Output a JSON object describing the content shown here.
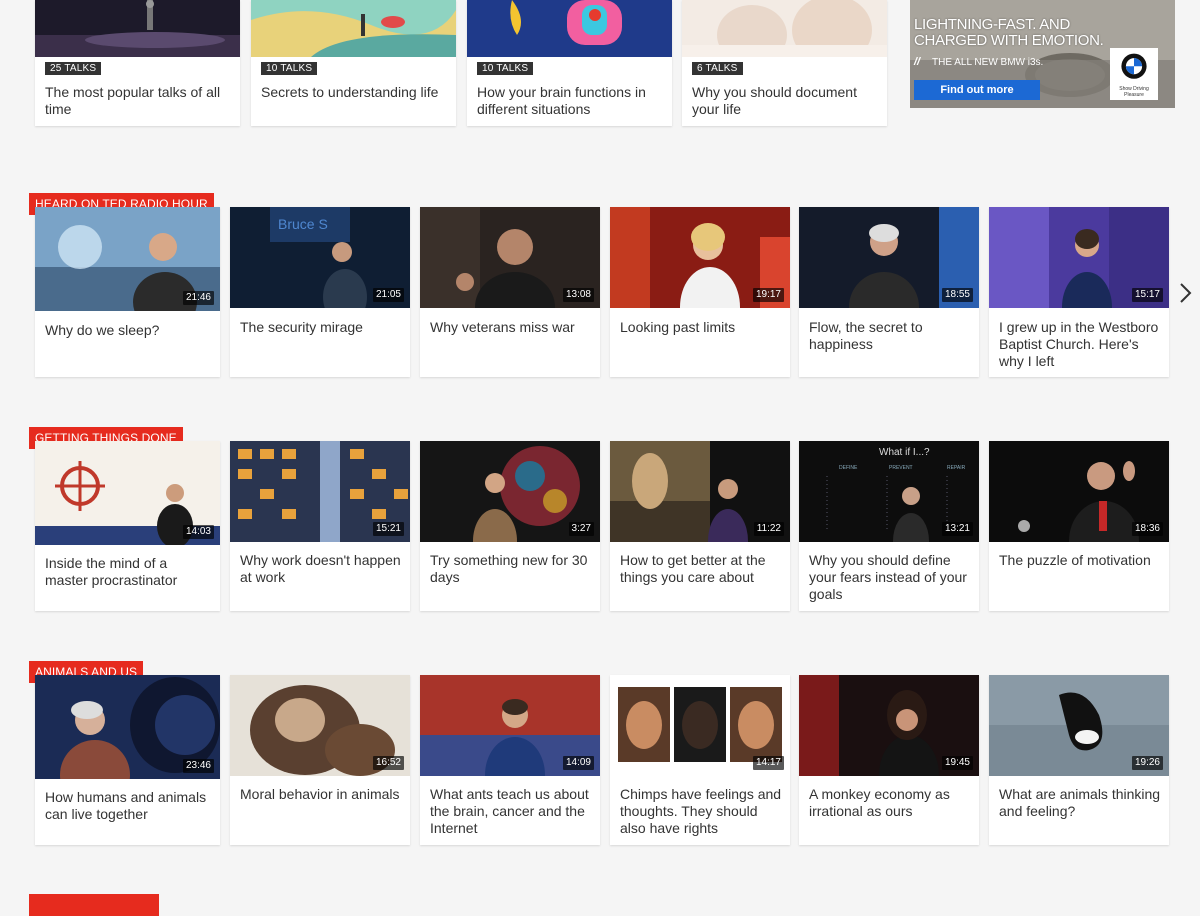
{
  "top_row": [
    {
      "badge": "25 TALKS",
      "title": "The most popular talks of all time"
    },
    {
      "badge": "10 TALKS",
      "title": "Secrets to understanding life"
    },
    {
      "badge": "10 TALKS",
      "title": "How your brain functions in different situations"
    },
    {
      "badge": "6 TALKS",
      "title": "Why you should document your life"
    }
  ],
  "ad": {
    "headline": "LIGHTNING-FAST. AND CHARGED WITH EMOTION.",
    "subline": "THE ALL NEW BMW i3s.",
    "cta": "Find out more",
    "logo_caption": "Show Driving Pleasure"
  },
  "sections": [
    {
      "label": "HEARD ON TED RADIO HOUR",
      "talks": [
        {
          "duration": "21:46",
          "title": "Why do we sleep?"
        },
        {
          "duration": "21:05",
          "title": "The security mirage"
        },
        {
          "duration": "13:08",
          "title": "Why veterans miss war"
        },
        {
          "duration": "19:17",
          "title": "Looking past limits"
        },
        {
          "duration": "18:55",
          "title": "Flow, the secret to happiness"
        },
        {
          "duration": "15:17",
          "title": "I grew up in the Westboro Baptist Church. Here's why I left"
        }
      ]
    },
    {
      "label": "GETTING THINGS DONE",
      "talks": [
        {
          "duration": "14:03",
          "title": "Inside the mind of a master procrastinator"
        },
        {
          "duration": "15:21",
          "title": "Why work doesn't happen at work"
        },
        {
          "duration": "3:27",
          "title": "Try something new for 30 days"
        },
        {
          "duration": "11:22",
          "title": "How to get better at the things you care about"
        },
        {
          "duration": "13:21",
          "title": "Why you should define your fears instead of your goals"
        },
        {
          "duration": "18:36",
          "title": "The puzzle of motivation"
        }
      ]
    },
    {
      "label": "ANIMALS AND US",
      "talks": [
        {
          "duration": "23:46",
          "title": "How humans and animals can live together"
        },
        {
          "duration": "16:52",
          "title": "Moral behavior in animals"
        },
        {
          "duration": "14:09",
          "title": "What ants teach us about the brain, cancer and the Internet"
        },
        {
          "duration": "14:17",
          "title": "Chimps have feelings and thoughts. They should also have rights"
        },
        {
          "duration": "19:45",
          "title": "A monkey economy as irrational as ours"
        },
        {
          "duration": "19:26",
          "title": "What are animals thinking and feeling?"
        }
      ]
    }
  ],
  "icons": {
    "next": "chevron-right-icon"
  },
  "colors": {
    "accent": "#e62b1e",
    "page_bg": "#f5f5f5",
    "badge_bg": "#333333"
  }
}
